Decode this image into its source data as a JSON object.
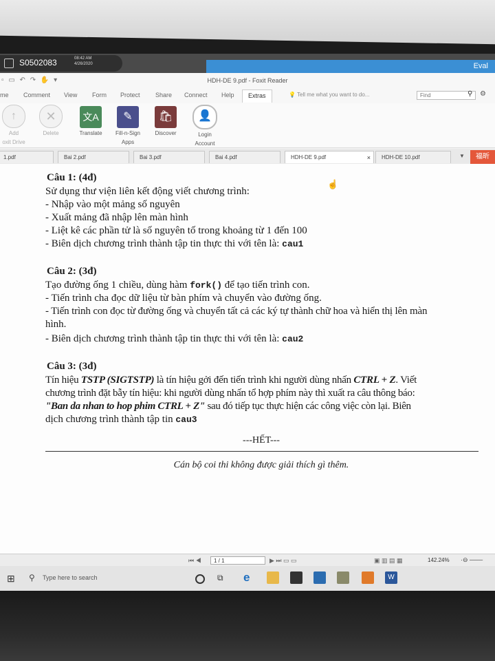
{
  "session": {
    "id": "S0502083",
    "time": "08:42 AM",
    "date": "4/26/2020"
  },
  "eval_label": "Eval",
  "app": {
    "title": "HDH-DE 9.pdf - Foxit Reader"
  },
  "ribbon_tabs": [
    "me",
    "Comment",
    "View",
    "Form",
    "Protect",
    "Share",
    "Connect",
    "Help",
    "Extras"
  ],
  "tell_me": "Tell me what you want to do...",
  "find_placeholder": "Find",
  "ribbon_buttons": [
    {
      "label": "Add",
      "label2": "oxit Drive",
      "icon": "cloud-upload-icon"
    },
    {
      "label": "Delete",
      "label2": "",
      "icon": "delete-icon"
    },
    {
      "label": "Translate",
      "label2": "",
      "icon": "translate-icon"
    },
    {
      "label": "Fill-n-Sign",
      "label2": "Apps",
      "icon": "fill-sign-icon"
    },
    {
      "label": "Discover",
      "label2": "",
      "icon": "discover-icon"
    },
    {
      "label": "Login",
      "label2": "Account",
      "icon": "account-icon"
    }
  ],
  "doc_tabs": [
    "1.pdf",
    "Bai 2.pdf",
    "Bai 3.pdf",
    "Bai 4.pdf",
    "HDH-DE 9.pdf",
    "HDH-DE 10.pdf"
  ],
  "doc_tab_close": "×",
  "hotkey_badge": "福昕",
  "document": {
    "q1_title": "Câu 1: (4đ)",
    "q1_lines": [
      "Sử dụng thư viện liên kết động viết chương trình:",
      "- Nhập vào một mảng số nguyên",
      "- Xuất mảng đã nhập lên màn hình",
      "- Liệt kê các phần tử là số nguyên tố trong khoảng từ 1 đến 100",
      "- Biên dịch chương trình thành tập tin thực thi với tên là: "
    ],
    "q1_code": "cau1",
    "q2_title": "Câu 2: (3đ)",
    "q2_l1a": "Tạo đường ống 1 chiều, dùng hàm ",
    "q2_fork": "fork()",
    "q2_l1b": " để tạo tiến trình con.",
    "q2_l2": "-  Tiến trình cha đọc dữ liệu từ bàn phím và chuyển vào đường ống.",
    "q2_l3": "- Tiến trình con đọc từ đường ống và chuyển tất cả các ký tự thành chữ hoa và hiển thị lên màn",
    "q2_l4": "hình.",
    "q2_l5": "-  Biên dịch chương trình thành tập tin thực thi với tên là: ",
    "q2_code": "cau2",
    "q3_title": "Câu 3: (3đ)",
    "q3_l1a": "Tín hiệu ",
    "q3_sig": "TSTP (SIGTSTP)",
    "q3_l1b": " là tín hiệu gởi đến tiến trình khi người dùng nhấn ",
    "q3_ctrl": "CTRL + Z",
    "q3_l1c": ". Viết",
    "q3_l2": "chương trình đặt bẫy tín hiệu: khi người dùng nhấn tổ hợp phím này thì xuất ra câu thông báo:",
    "q3_msg": "\"Ban da nhan to hop phim CTRL + Z\"",
    "q3_l3b": " sau đó tiếp tục thực hiện các công việc còn lại. Biên",
    "q3_l4": "dịch chương trình thành tập tin ",
    "q3_code": "cau3",
    "end": "---HẾT---",
    "note": "Cán bộ coi thi không được giải thích gì thêm."
  },
  "status": {
    "page": "1 / 1",
    "zoom": "142.24%"
  },
  "taskbar": {
    "search": "Type here to search"
  }
}
